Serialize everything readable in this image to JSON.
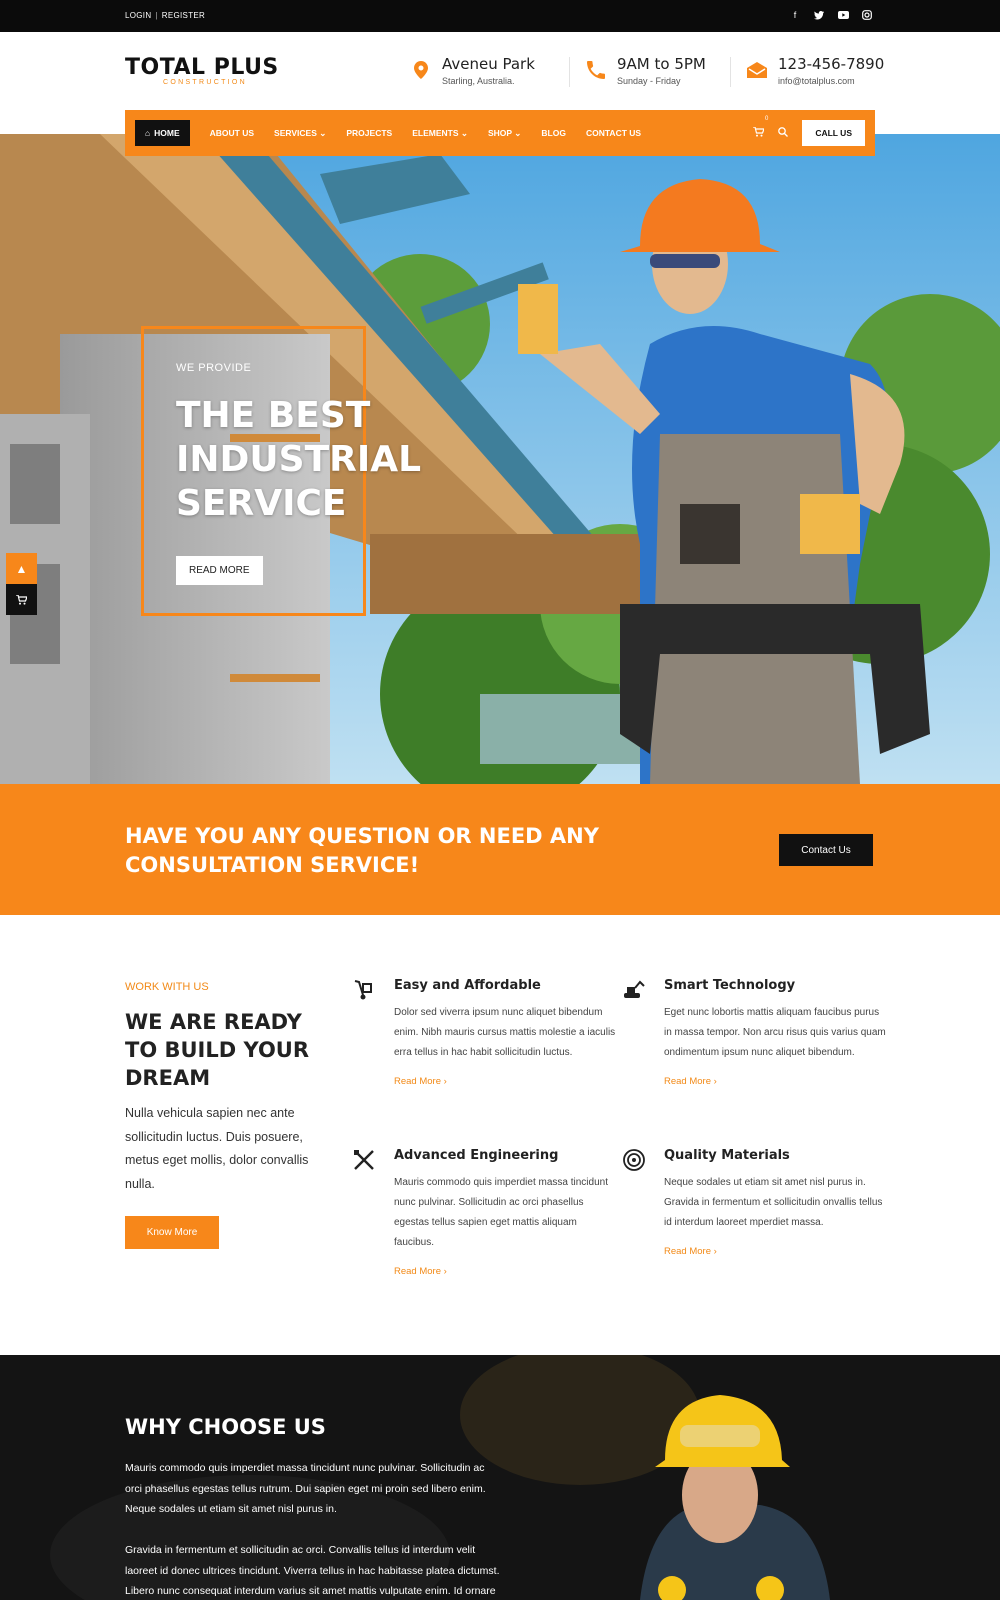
{
  "topbar": {
    "login": "LOGIN",
    "register": "REGISTER",
    "social": [
      "facebook-icon",
      "twitter-icon",
      "youtube-icon",
      "instagram-icon"
    ]
  },
  "header": {
    "logo_name": "TOTAL PLUS",
    "logo_sub": "CONSTRUCTION",
    "address_title": "Aveneu Park",
    "address_sub": "Starling, Australia.",
    "hours_title": "9AM to 5PM",
    "hours_sub": "Sunday - Friday",
    "phone_title": "123-456-7890",
    "phone_sub": "info@totalplus.com"
  },
  "nav": {
    "items": [
      "HOME",
      "ABOUT US",
      "SERVICES",
      "PROJECTS",
      "ELEMENTS",
      "SHOP",
      "BLOG",
      "CONTACT US"
    ],
    "cart_count": "0",
    "call": "CALL US"
  },
  "hero": {
    "kicker": "WE PROVIDE",
    "title": "THE BEST INDUSTRIAL SERVICE",
    "button": "READ MORE"
  },
  "cta": {
    "text": "HAVE YOU ANY QUESTION OR NEED ANY CONSULTATION SERVICE!",
    "button": "Contact Us"
  },
  "work": {
    "kicker": "WORK WITH US",
    "title": "WE ARE READY TO BUILD YOUR DREAM",
    "text": "Nulla vehicula sapien nec ante sollicitudin luctus. Duis posuere, metus eget mollis, dolor convallis nulla.",
    "button": "Know More",
    "features": [
      {
        "icon": "hand-truck-icon",
        "title": "Easy and Affordable",
        "text": "Dolor sed viverra ipsum nunc aliquet bibendum enim. Nibh mauris cursus mattis molestie a iaculis erra tellus in hac habit sollicitudin luctus.",
        "link": "Read More ›"
      },
      {
        "icon": "excavator-icon",
        "title": "Smart Technology",
        "text": "Eget nunc lobortis mattis aliquam faucibus purus in massa tempor. Non arcu risus quis varius quam ondimentum ipsum nunc aliquet bibendum.",
        "link": "Read More ›"
      },
      {
        "icon": "crossed-tools-icon",
        "title": "Advanced Engineering",
        "text": "Mauris commodo quis imperdiet massa tincidunt nunc pulvinar. Sollicitudin ac orci phasellus egestas tellus sapien eget mattis aliquam faucibus.",
        "link": "Read More ›"
      },
      {
        "icon": "target-icon",
        "title": "Quality Materials",
        "text": "Neque sodales ut etiam sit amet nisl purus in. Gravida in fermentum et sollicitudin onvallis tellus id interdum laoreet mperdiet massa.",
        "link": "Read More ›"
      }
    ]
  },
  "why": {
    "title": "WHY CHOOSE US",
    "p1": "Mauris commodo quis imperdiet massa tincidunt nunc pulvinar. Sollicitudin ac orci phasellus egestas tellus rutrum. Dui sapien eget mi proin sed libero enim. Neque sodales ut etiam sit amet nisl purus in.",
    "p2": "Gravida in fermentum et sollicitudin ac orci. Convallis tellus id interdum velit laoreet id donec ultrices tincidunt. Viverra tellus in hac habitasse platea dictumst. Libero nunc consequat interdum varius sit amet mattis vulputate enim. Id ornare arcu odio ut sem. Venenatis tellus in metus vulputate eu."
  },
  "colors": {
    "accent": "#f7871a",
    "dark": "#111111"
  }
}
